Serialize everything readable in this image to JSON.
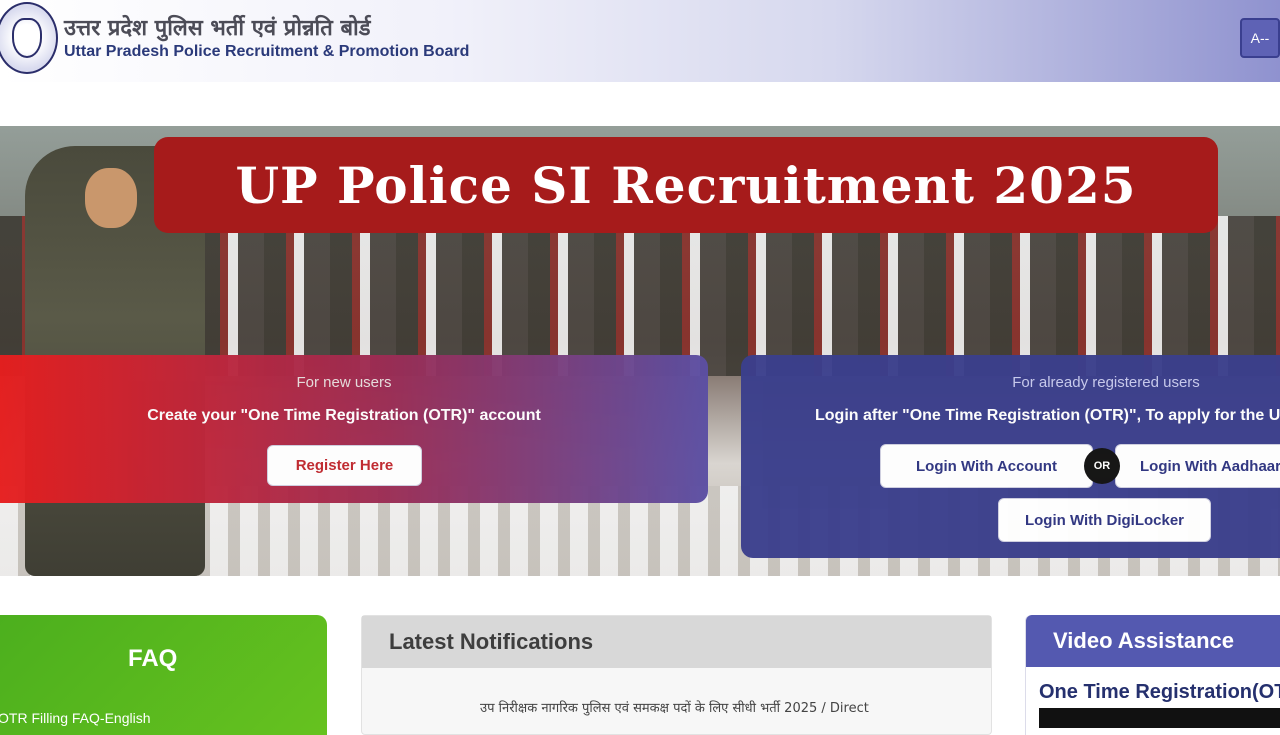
{
  "header": {
    "hindi_title": "उत्तर प्रदेश पुलिस भर्ती एवं प्रोन्नति बोर्ड",
    "english_title": "Uttar Pradesh Police Recruitment & Promotion Board",
    "font_size_button": "A--"
  },
  "banner": {
    "title": "UP Police SI Recruitment 2025"
  },
  "new_users": {
    "subtitle": "For new users",
    "message": "Create your \"One Time Registration (OTR)\" account",
    "register_button": "Register Here"
  },
  "registered_users": {
    "subtitle": "For already registered users",
    "message": "Login after \"One Time Registration (OTR)\", To apply for the UPI",
    "login_account_button": "Login With Account",
    "or_label": "OR",
    "login_aadhaar_button": "Login With Aadhaar",
    "login_digilocker_button": "Login With DigiLocker"
  },
  "faq": {
    "title": "FAQ",
    "link": "OTR Filling FAQ-English"
  },
  "notifications": {
    "title": "Latest Notifications",
    "item": "उप निरीक्षक नागरिक पुलिस एवं समकक्ष पदों के लिए सीधी भर्ती 2025 / Direct"
  },
  "video": {
    "title": "Video Assistance",
    "subtitle": "One Time Registration(OTR)"
  },
  "colors": {
    "banner_red": "#a61b1b",
    "brand_blue": "#3b3f8c",
    "faq_green": "#5cb81f"
  }
}
